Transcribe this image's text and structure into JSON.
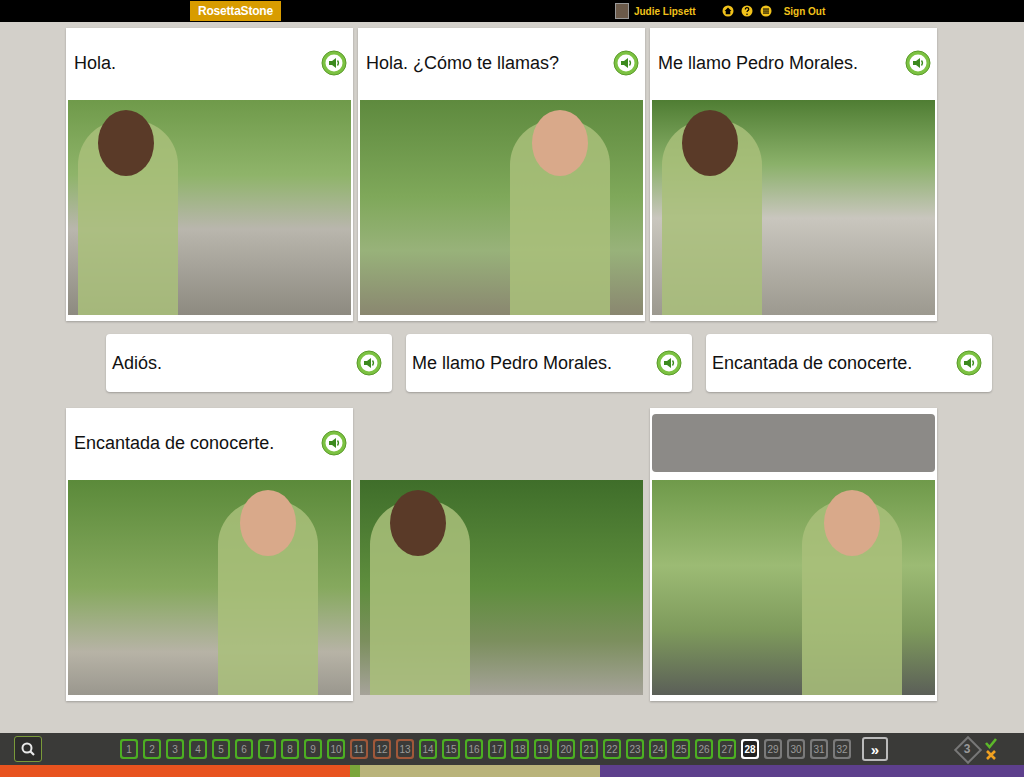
{
  "top_bar": {
    "logo": "RosettaStone",
    "user": "Judie Lipsett",
    "sign_out": "Sign Out"
  },
  "top_cards": [
    {
      "text": "Hola."
    },
    {
      "text": "Hola. ¿Cómo te llamas?"
    },
    {
      "text": "Me llamo Pedro Morales."
    }
  ],
  "answer_tiles": [
    {
      "text": "Adiós."
    },
    {
      "text": "Me llamo Pedro Morales."
    },
    {
      "text": "Encantada de conocerte."
    }
  ],
  "bottom_cards": [
    {
      "kind": "caption",
      "text": "Encantada de conocerte."
    },
    {
      "kind": "photo-only"
    },
    {
      "kind": "empty-slot"
    }
  ],
  "pager": {
    "pages": [
      {
        "label": "1",
        "color": "#4caf22",
        "selected": false
      },
      {
        "label": "2",
        "color": "#4caf22",
        "selected": false
      },
      {
        "label": "3",
        "color": "#4caf22",
        "selected": false
      },
      {
        "label": "4",
        "color": "#4caf22",
        "selected": false
      },
      {
        "label": "5",
        "color": "#4caf22",
        "selected": false
      },
      {
        "label": "6",
        "color": "#4caf22",
        "selected": false
      },
      {
        "label": "7",
        "color": "#4caf22",
        "selected": false
      },
      {
        "label": "8",
        "color": "#4caf22",
        "selected": false
      },
      {
        "label": "9",
        "color": "#4caf22",
        "selected": false
      },
      {
        "label": "10",
        "color": "#4caf22",
        "selected": false
      },
      {
        "label": "11",
        "color": "#a0583a",
        "selected": false
      },
      {
        "label": "12",
        "color": "#a0583a",
        "selected": false
      },
      {
        "label": "13",
        "color": "#a0583a",
        "selected": false
      },
      {
        "label": "14",
        "color": "#4caf22",
        "selected": false
      },
      {
        "label": "15",
        "color": "#4caf22",
        "selected": false
      },
      {
        "label": "16",
        "color": "#4caf22",
        "selected": false
      },
      {
        "label": "17",
        "color": "#4caf22",
        "selected": false
      },
      {
        "label": "18",
        "color": "#4caf22",
        "selected": false
      },
      {
        "label": "19",
        "color": "#4caf22",
        "selected": false
      },
      {
        "label": "20",
        "color": "#4caf22",
        "selected": false
      },
      {
        "label": "21",
        "color": "#4caf22",
        "selected": false
      },
      {
        "label": "22",
        "color": "#4caf22",
        "selected": false
      },
      {
        "label": "23",
        "color": "#4caf22",
        "selected": false
      },
      {
        "label": "24",
        "color": "#4caf22",
        "selected": false
      },
      {
        "label": "25",
        "color": "#4caf22",
        "selected": false
      },
      {
        "label": "26",
        "color": "#4caf22",
        "selected": false
      },
      {
        "label": "27",
        "color": "#4caf22",
        "selected": false
      },
      {
        "label": "28",
        "color": "#ffffff",
        "selected": true
      },
      {
        "label": "29",
        "color": "#7a7a7a",
        "selected": false
      },
      {
        "label": "30",
        "color": "#7a7a7a",
        "selected": false
      },
      {
        "label": "31",
        "color": "#7a7a7a",
        "selected": false
      },
      {
        "label": "32",
        "color": "#7a7a7a",
        "selected": false
      }
    ],
    "next": "»"
  },
  "attempts": "3"
}
